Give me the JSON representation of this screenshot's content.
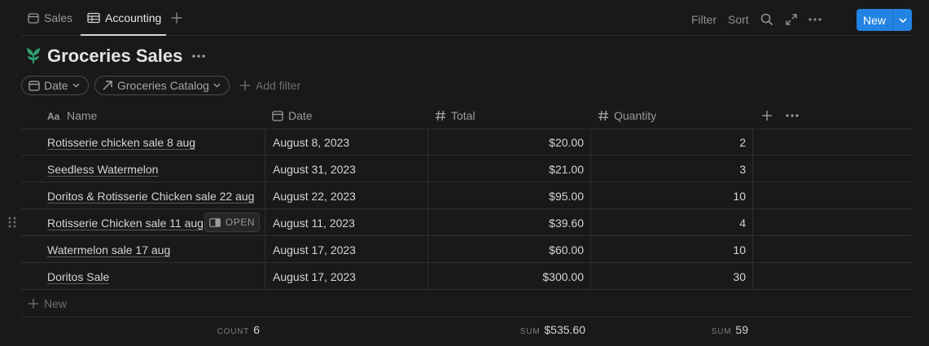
{
  "tabs": [
    {
      "label": "Sales",
      "icon": "calendar-icon",
      "active": false
    },
    {
      "label": "Accounting",
      "icon": "table-icon",
      "active": true
    }
  ],
  "toolbar": {
    "filter_label": "Filter",
    "sort_label": "Sort",
    "new_label": "New",
    "new_button_color": "#2383e2"
  },
  "database": {
    "title": "Groceries Sales",
    "icon": "sprout-icon",
    "icon_color": "#2f9e6e"
  },
  "filters": {
    "chips": [
      {
        "label": "Date",
        "icon": "calendar-icon"
      },
      {
        "label": "Groceries Catalog",
        "icon": "relation-arrow-icon"
      }
    ],
    "add_filter_label": "Add filter"
  },
  "table": {
    "columns": [
      {
        "label": "Name",
        "icon": "text-aa-icon"
      },
      {
        "label": "Date",
        "icon": "calendar-icon"
      },
      {
        "label": "Total",
        "icon": "hash-icon"
      },
      {
        "label": "Quantity",
        "icon": "hash-icon"
      }
    ],
    "rows": [
      {
        "name": "Rotisserie chicken sale 8 aug",
        "date": "August 8, 2023",
        "total": "$20.00",
        "quantity": "2"
      },
      {
        "name": "Seedless Watermelon",
        "date": "August 31, 2023",
        "total": "$21.00",
        "quantity": "3"
      },
      {
        "name": "Doritos & Rotisserie Chicken sale 22 aug",
        "date": "August 22, 2023",
        "total": "$95.00",
        "quantity": "10"
      },
      {
        "name": "Rotisserie Chicken sale 11 aug",
        "date": "August 11, 2023",
        "total": "$39.60",
        "quantity": "4"
      },
      {
        "name": "Watermelon sale 17 aug",
        "date": "August 17, 2023",
        "total": "$60.00",
        "quantity": "10"
      },
      {
        "name": "Doritos Sale",
        "date": "August 17, 2023",
        "total": "$300.00",
        "quantity": "30"
      }
    ],
    "hovered_row_open_label": "OPEN",
    "new_row_label": "New",
    "footer": {
      "count_key": "COUNT",
      "count_value": "6",
      "sum_total_key": "SUM",
      "sum_total_value": "$535.60",
      "sum_qty_key": "SUM",
      "sum_qty_value": "59"
    }
  }
}
